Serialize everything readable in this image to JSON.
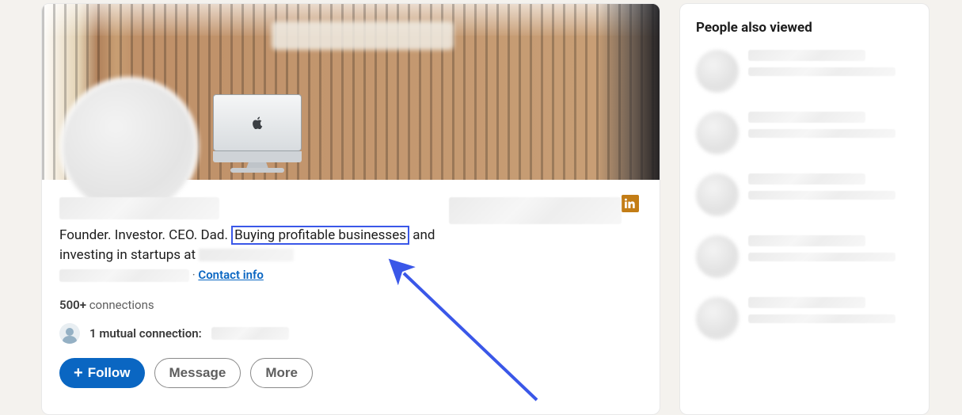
{
  "profile": {
    "headline_prefix": "Founder. Investor. CEO. Dad.",
    "headline_highlight": "Buying profitable businesses",
    "headline_suffix_before_blur": "and investing in startups at",
    "contact_info_label": "Contact info",
    "connections_count": "500+",
    "connections_word": "connections",
    "mutual_count": "1",
    "mutual_label": "mutual connection:",
    "separator": "·"
  },
  "actions": {
    "follow": "Follow",
    "message": "Message",
    "more": "More"
  },
  "sidebar": {
    "title": "People also viewed"
  },
  "icons": {
    "plus_glyph": "+"
  }
}
